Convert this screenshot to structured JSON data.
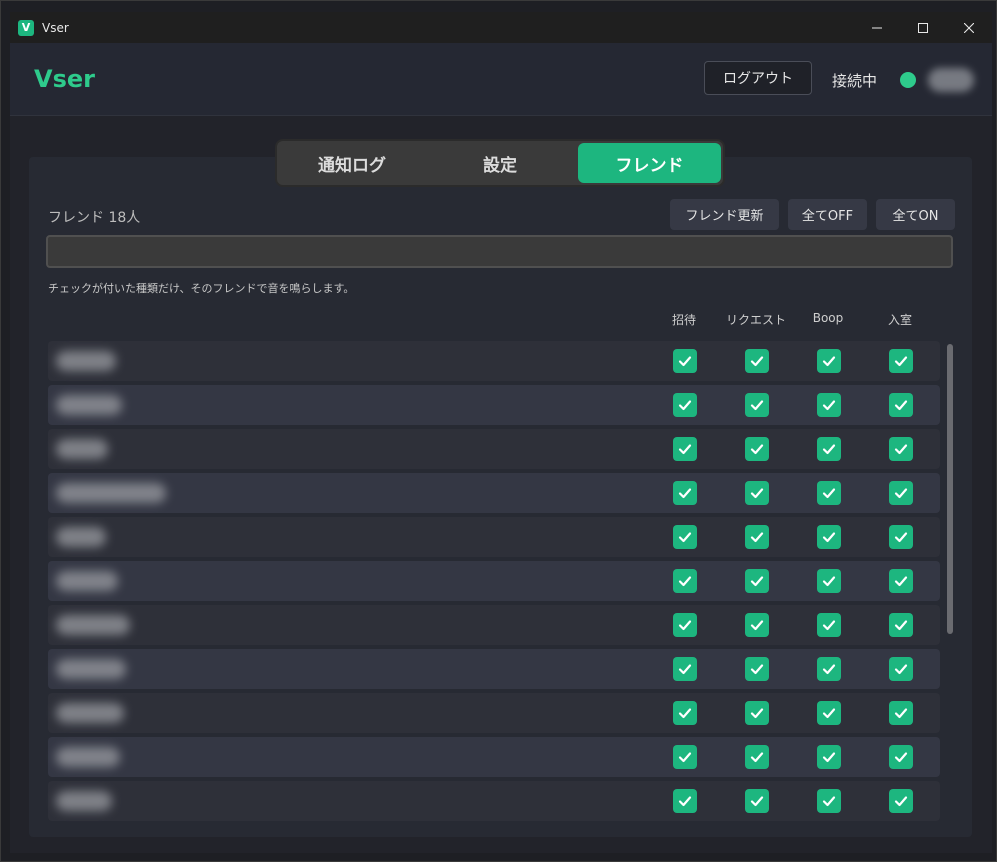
{
  "window": {
    "title": "Vser",
    "app_icon_letter": "V"
  },
  "header": {
    "brand": "Vser",
    "logout_label": "ログアウト",
    "connection_label": "接続中",
    "status_color": "#2ecb8c"
  },
  "tabs": [
    {
      "label": "通知ログ",
      "active": false
    },
    {
      "label": "設定",
      "active": false
    },
    {
      "label": "フレンド",
      "active": true
    }
  ],
  "friends": {
    "count_label": "フレンド 18人",
    "refresh_label": "フレンド更新",
    "all_off_label": "全てOFF",
    "all_on_label": "全てON",
    "search_value": "",
    "hint": "チェックが付いた種類だけ、そのフレンドで音を鳴らします。",
    "columns": [
      "招待",
      "リクエスト",
      "Boop",
      "入室"
    ],
    "rows": [
      {
        "name": "",
        "invite": true,
        "request": true,
        "boop": true,
        "join": true
      },
      {
        "name": "",
        "invite": true,
        "request": true,
        "boop": true,
        "join": true
      },
      {
        "name": "",
        "invite": true,
        "request": true,
        "boop": true,
        "join": true
      },
      {
        "name": "",
        "invite": true,
        "request": true,
        "boop": true,
        "join": true
      },
      {
        "name": "",
        "invite": true,
        "request": true,
        "boop": true,
        "join": true
      },
      {
        "name": "",
        "invite": true,
        "request": true,
        "boop": true,
        "join": true
      },
      {
        "name": "",
        "invite": true,
        "request": true,
        "boop": true,
        "join": true
      },
      {
        "name": "",
        "invite": true,
        "request": true,
        "boop": true,
        "join": true
      },
      {
        "name": "",
        "invite": true,
        "request": true,
        "boop": true,
        "join": true
      },
      {
        "name": "",
        "invite": true,
        "request": true,
        "boop": true,
        "join": true
      },
      {
        "name": "",
        "invite": true,
        "request": true,
        "boop": true,
        "join": true
      }
    ]
  },
  "colors": {
    "accent": "#1db67f",
    "brand": "#2ecb8c"
  }
}
